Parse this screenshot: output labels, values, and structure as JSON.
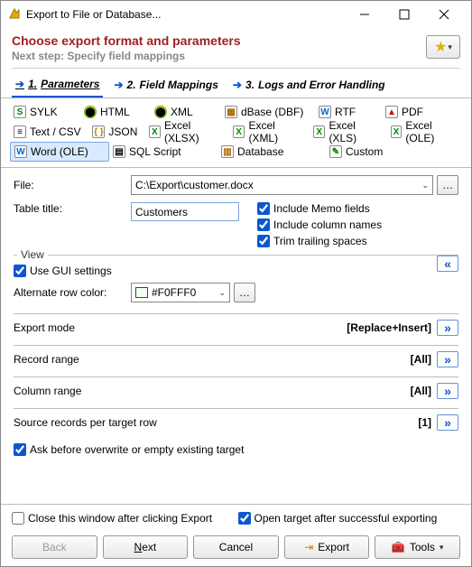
{
  "title": "Export to File or Database...",
  "header": {
    "title": "Choose export format and parameters",
    "sub": "Next step: Specify field mappings"
  },
  "tabs": [
    {
      "num": "1.",
      "label": "Parameters",
      "active": true
    },
    {
      "num": "2.",
      "label": "Field Mappings",
      "active": false
    },
    {
      "num": "3.",
      "label": "Logs and Error Handling",
      "active": false
    }
  ],
  "formats": {
    "row1": [
      "SYLK",
      "HTML",
      "XML",
      "dBase (DBF)",
      "RTF",
      "PDF"
    ],
    "row2": [
      "Text / CSV",
      "JSON",
      "Excel (XLSX)",
      "Excel (XML)",
      "Excel (XLS)",
      "Excel (OLE)"
    ],
    "row3": [
      "Word (OLE)",
      "SQL Script",
      "Database",
      "Custom"
    ],
    "selected": "Word (OLE)"
  },
  "file": {
    "label": "File:",
    "value": "C:\\Export\\customer.docx"
  },
  "table_title": {
    "label": "Table title:",
    "value": "Customers"
  },
  "checks": {
    "memo": {
      "label": "Include Memo fields",
      "checked": true
    },
    "colnames": {
      "label": "Include column names",
      "checked": true
    },
    "trim": {
      "label": "Trim trailing spaces",
      "checked": true
    }
  },
  "view": {
    "title": "View",
    "use_gui": {
      "label": "Use GUI settings",
      "checked": true
    },
    "alt_row": {
      "label": "Alternate row color:",
      "value": "#F0FFF0",
      "color": "#F0FFF0"
    }
  },
  "summary": {
    "export_mode": {
      "label": "Export mode",
      "value": "[Replace+Insert]"
    },
    "record_range": {
      "label": "Record range",
      "value": "[All]"
    },
    "column_range": {
      "label": "Column range",
      "value": "[All]"
    },
    "src_per_row": {
      "label": "Source records per target row",
      "value": "[1]"
    }
  },
  "ask_overwrite": {
    "label": "Ask before overwrite or empty existing target",
    "checked": true
  },
  "bottom_checks": {
    "close_after": {
      "label": "Close this window after clicking Export",
      "checked": false
    },
    "open_target": {
      "label": "Open target after successful exporting",
      "checked": true
    }
  },
  "buttons": {
    "back": "Back",
    "next": "Next",
    "cancel": "Cancel",
    "export": "Export",
    "tools": "Tools"
  }
}
